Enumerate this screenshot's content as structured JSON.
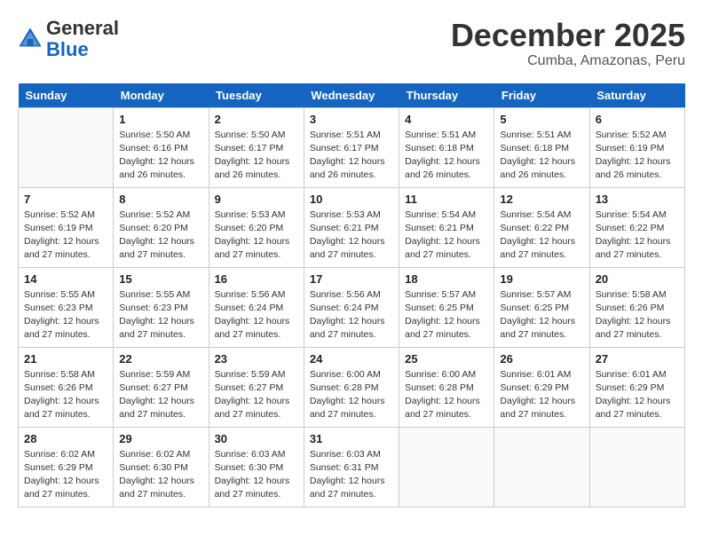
{
  "header": {
    "logo_general": "General",
    "logo_blue": "Blue",
    "month_year": "December 2025",
    "location": "Cumba, Amazonas, Peru"
  },
  "weekdays": [
    "Sunday",
    "Monday",
    "Tuesday",
    "Wednesday",
    "Thursday",
    "Friday",
    "Saturday"
  ],
  "weeks": [
    [
      {
        "day": "",
        "info": ""
      },
      {
        "day": "1",
        "info": "Sunrise: 5:50 AM\nSunset: 6:16 PM\nDaylight: 12 hours\nand 26 minutes."
      },
      {
        "day": "2",
        "info": "Sunrise: 5:50 AM\nSunset: 6:17 PM\nDaylight: 12 hours\nand 26 minutes."
      },
      {
        "day": "3",
        "info": "Sunrise: 5:51 AM\nSunset: 6:17 PM\nDaylight: 12 hours\nand 26 minutes."
      },
      {
        "day": "4",
        "info": "Sunrise: 5:51 AM\nSunset: 6:18 PM\nDaylight: 12 hours\nand 26 minutes."
      },
      {
        "day": "5",
        "info": "Sunrise: 5:51 AM\nSunset: 6:18 PM\nDaylight: 12 hours\nand 26 minutes."
      },
      {
        "day": "6",
        "info": "Sunrise: 5:52 AM\nSunset: 6:19 PM\nDaylight: 12 hours\nand 26 minutes."
      }
    ],
    [
      {
        "day": "7",
        "info": "Sunrise: 5:52 AM\nSunset: 6:19 PM\nDaylight: 12 hours\nand 27 minutes."
      },
      {
        "day": "8",
        "info": "Sunrise: 5:52 AM\nSunset: 6:20 PM\nDaylight: 12 hours\nand 27 minutes."
      },
      {
        "day": "9",
        "info": "Sunrise: 5:53 AM\nSunset: 6:20 PM\nDaylight: 12 hours\nand 27 minutes."
      },
      {
        "day": "10",
        "info": "Sunrise: 5:53 AM\nSunset: 6:21 PM\nDaylight: 12 hours\nand 27 minutes."
      },
      {
        "day": "11",
        "info": "Sunrise: 5:54 AM\nSunset: 6:21 PM\nDaylight: 12 hours\nand 27 minutes."
      },
      {
        "day": "12",
        "info": "Sunrise: 5:54 AM\nSunset: 6:22 PM\nDaylight: 12 hours\nand 27 minutes."
      },
      {
        "day": "13",
        "info": "Sunrise: 5:54 AM\nSunset: 6:22 PM\nDaylight: 12 hours\nand 27 minutes."
      }
    ],
    [
      {
        "day": "14",
        "info": "Sunrise: 5:55 AM\nSunset: 6:23 PM\nDaylight: 12 hours\nand 27 minutes."
      },
      {
        "day": "15",
        "info": "Sunrise: 5:55 AM\nSunset: 6:23 PM\nDaylight: 12 hours\nand 27 minutes."
      },
      {
        "day": "16",
        "info": "Sunrise: 5:56 AM\nSunset: 6:24 PM\nDaylight: 12 hours\nand 27 minutes."
      },
      {
        "day": "17",
        "info": "Sunrise: 5:56 AM\nSunset: 6:24 PM\nDaylight: 12 hours\nand 27 minutes."
      },
      {
        "day": "18",
        "info": "Sunrise: 5:57 AM\nSunset: 6:25 PM\nDaylight: 12 hours\nand 27 minutes."
      },
      {
        "day": "19",
        "info": "Sunrise: 5:57 AM\nSunset: 6:25 PM\nDaylight: 12 hours\nand 27 minutes."
      },
      {
        "day": "20",
        "info": "Sunrise: 5:58 AM\nSunset: 6:26 PM\nDaylight: 12 hours\nand 27 minutes."
      }
    ],
    [
      {
        "day": "21",
        "info": "Sunrise: 5:58 AM\nSunset: 6:26 PM\nDaylight: 12 hours\nand 27 minutes."
      },
      {
        "day": "22",
        "info": "Sunrise: 5:59 AM\nSunset: 6:27 PM\nDaylight: 12 hours\nand 27 minutes."
      },
      {
        "day": "23",
        "info": "Sunrise: 5:59 AM\nSunset: 6:27 PM\nDaylight: 12 hours\nand 27 minutes."
      },
      {
        "day": "24",
        "info": "Sunrise: 6:00 AM\nSunset: 6:28 PM\nDaylight: 12 hours\nand 27 minutes."
      },
      {
        "day": "25",
        "info": "Sunrise: 6:00 AM\nSunset: 6:28 PM\nDaylight: 12 hours\nand 27 minutes."
      },
      {
        "day": "26",
        "info": "Sunrise: 6:01 AM\nSunset: 6:29 PM\nDaylight: 12 hours\nand 27 minutes."
      },
      {
        "day": "27",
        "info": "Sunrise: 6:01 AM\nSunset: 6:29 PM\nDaylight: 12 hours\nand 27 minutes."
      }
    ],
    [
      {
        "day": "28",
        "info": "Sunrise: 6:02 AM\nSunset: 6:29 PM\nDaylight: 12 hours\nand 27 minutes."
      },
      {
        "day": "29",
        "info": "Sunrise: 6:02 AM\nSunset: 6:30 PM\nDaylight: 12 hours\nand 27 minutes."
      },
      {
        "day": "30",
        "info": "Sunrise: 6:03 AM\nSunset: 6:30 PM\nDaylight: 12 hours\nand 27 minutes."
      },
      {
        "day": "31",
        "info": "Sunrise: 6:03 AM\nSunset: 6:31 PM\nDaylight: 12 hours\nand 27 minutes."
      },
      {
        "day": "",
        "info": ""
      },
      {
        "day": "",
        "info": ""
      },
      {
        "day": "",
        "info": ""
      }
    ]
  ]
}
